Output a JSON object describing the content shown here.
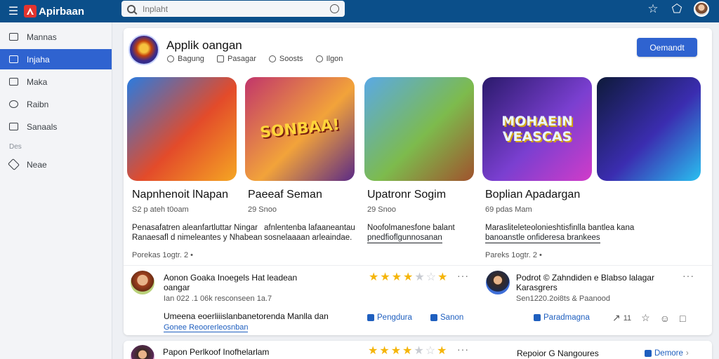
{
  "header": {
    "brand": "Apirbaan",
    "search_placeholder": "Inplaht"
  },
  "sidebar": {
    "items": [
      {
        "label": "Mannas",
        "active": false
      },
      {
        "label": "Injaha",
        "active": true
      },
      {
        "label": "Maka",
        "active": false
      },
      {
        "label": "Raibn",
        "active": false
      },
      {
        "label": "Sanaals",
        "active": false
      }
    ],
    "section_label": "Des",
    "section_items": [
      {
        "label": "Neae"
      }
    ]
  },
  "app": {
    "title": "Applik oangan",
    "meta": [
      "Bagung",
      "Pasagar",
      "Soosts",
      "Ilgon"
    ],
    "cta_label": "Oemandt"
  },
  "games": [
    {
      "thumb_text": "",
      "colors": [
        "#2a7be0",
        "#e34b2a",
        "#f5a623"
      ],
      "title": "Napnhenoit lNapan",
      "sub": "S2 p ateh t0oam",
      "desc_line1": "Penasafatren aleanfartluttar Ningar",
      "desc_line2": "Ranaesafl d nimeleantes y Nhabean",
      "foot": "Porekas    1ogtr. 2 •"
    },
    {
      "thumb_text": "SONBAA!",
      "colors": [
        "#c1356b",
        "#f2a33a",
        "#5b2a86"
      ],
      "title": "Paeeaf Seman",
      "sub": "29 Snoo",
      "desc_line1": "afnlentenba lafaaneantau",
      "desc_line2": "sosnelaaaan arleaindae.",
      "foot": ""
    },
    {
      "thumb_text": "",
      "colors": [
        "#5aa9e6",
        "#7dbb4d",
        "#a0522d"
      ],
      "title": "Upatronr Sogim",
      "sub": "29 Snoo",
      "desc_line1": "Noofolmanesfone balant",
      "desc_line2": "pnedfioflgunnosanan",
      "foot": ""
    },
    {
      "thumb_text": "MOHAEIN VEASCAS",
      "colors": [
        "#2a1a6b",
        "#7a3fd0",
        "#d13cc9"
      ],
      "title": "Boplian Apadargan",
      "sub": "69 pdas Mam",
      "desc_line1": "Marasliteleteolonieshtisfinlla bantlea kana",
      "desc_line2": "banoanstle onfideresa brankees",
      "foot": "Pareks    1ogtr. 2 •"
    },
    {
      "thumb_text": "",
      "colors": [
        "#0e1a3a",
        "#3b2db0",
        "#29c0f0"
      ],
      "title": "",
      "sub": "",
      "desc_line1": "",
      "desc_line2": "",
      "foot": ""
    }
  ],
  "reviews": [
    {
      "name_line1": "Aonon Goaka Inoegels Hat leadean",
      "name_line2": "oangar",
      "date": "Ian 022 .1 06k resconseen 1a.7",
      "text": "Umeena eoerliiislanbanetorenda Manlla dan",
      "link": "Gonee Reoorerleosnban",
      "stars": 4,
      "actions": [
        "Pengdura",
        "Sanon"
      ]
    },
    {
      "name_line1": "Podrot © Zahndiden e Blabso lalagar",
      "name_line2": "Karasgrers",
      "date": "Sen1220.2oi8ts & Paanood",
      "stars": 0,
      "actions": [
        "Paradmagna"
      ],
      "counter": "11"
    }
  ],
  "second_card": {
    "name": "Papon Perlkoof Inofhelarlam",
    "stars": 4,
    "more_text": "Repoior G Nangoures",
    "action": "Demore"
  }
}
